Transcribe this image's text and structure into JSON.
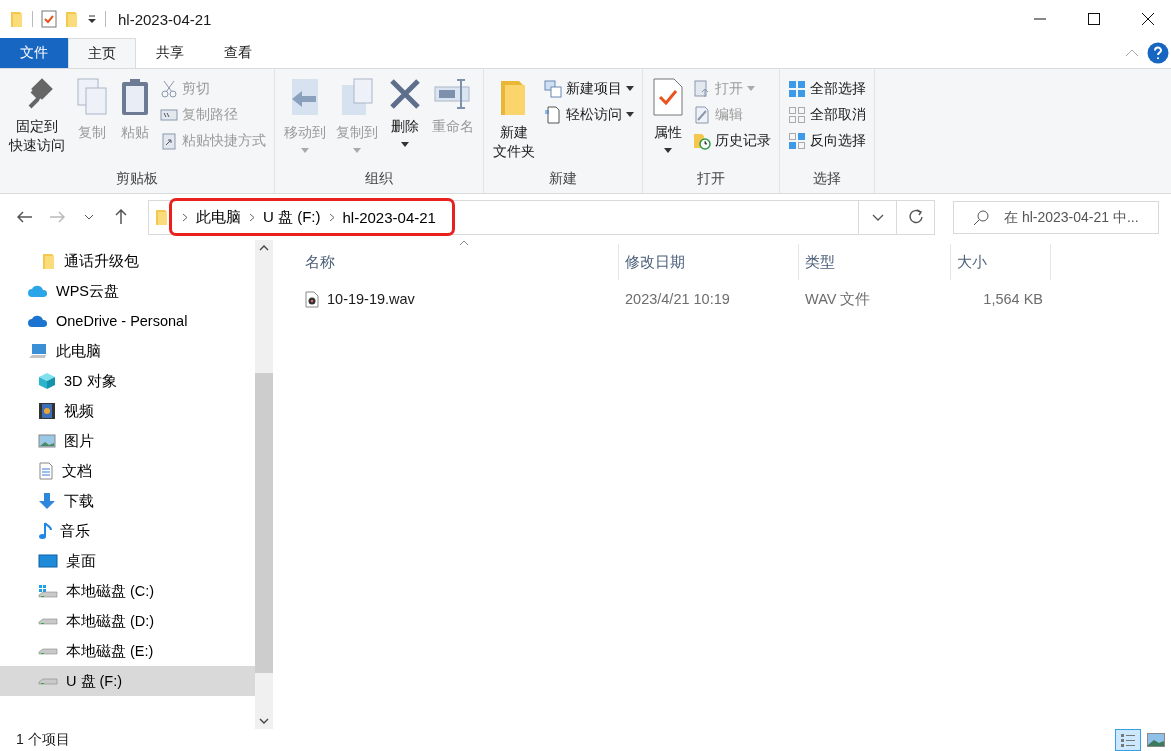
{
  "title_bar": {
    "title": "hl-2023-04-21"
  },
  "ribbon_tabs": [
    {
      "label": "文件",
      "kind": "file",
      "selected": false
    },
    {
      "label": "主页",
      "kind": "tab",
      "selected": true
    },
    {
      "label": "共享",
      "kind": "tab",
      "selected": false
    },
    {
      "label": "查看",
      "kind": "tab",
      "selected": false
    }
  ],
  "ribbon_groups": [
    {
      "label": "剪贴板",
      "columns": [
        {
          "kind": "large",
          "items": [
            {
              "label_lines": [
                "固定到",
                "快速访问"
              ],
              "disabled": false,
              "dropdown": false
            }
          ]
        },
        {
          "kind": "large",
          "items": [
            {
              "label": "复制",
              "disabled": true,
              "dropdown": false
            }
          ]
        },
        {
          "kind": "large",
          "items": [
            {
              "label": "粘贴",
              "disabled": true,
              "dropdown": false
            }
          ]
        },
        {
          "kind": "stack",
          "items": [
            {
              "label": "剪切",
              "disabled": true,
              "dropdown": false
            },
            {
              "label": "复制路径",
              "disabled": true,
              "dropdown": false
            },
            {
              "label": "粘贴快捷方式",
              "disabled": true,
              "dropdown": false
            }
          ]
        }
      ]
    },
    {
      "label": "组织",
      "columns": [
        {
          "kind": "large",
          "items": [
            {
              "label": "移动到",
              "disabled": true,
              "dropdown": true
            }
          ]
        },
        {
          "kind": "large",
          "items": [
            {
              "label": "复制到",
              "disabled": true,
              "dropdown": true
            }
          ]
        },
        {
          "kind": "large",
          "items": [
            {
              "label": "删除",
              "disabled": false,
              "dropdown": true
            }
          ]
        },
        {
          "kind": "large",
          "items": [
            {
              "label": "重命名",
              "disabled": true,
              "dropdown": false
            }
          ]
        }
      ]
    },
    {
      "label": "新建",
      "columns": [
        {
          "kind": "large",
          "items": [
            {
              "label_lines": [
                "新建",
                "文件夹"
              ],
              "disabled": false,
              "dropdown": false
            }
          ]
        },
        {
          "kind": "stack",
          "items": [
            {
              "label": "新建项目",
              "disabled": false,
              "dropdown": true
            },
            {
              "label": "轻松访问",
              "disabled": false,
              "dropdown": true
            }
          ]
        }
      ]
    },
    {
      "label": "打开",
      "columns": [
        {
          "kind": "large",
          "items": [
            {
              "label": "属性",
              "disabled": false,
              "dropdown": true
            }
          ]
        },
        {
          "kind": "stack",
          "items": [
            {
              "label": "打开",
              "disabled": true,
              "dropdown": true
            },
            {
              "label": "编辑",
              "disabled": true,
              "dropdown": false
            },
            {
              "label": "历史记录",
              "disabled": false,
              "dropdown": false
            }
          ]
        }
      ]
    },
    {
      "label": "选择",
      "columns": [
        {
          "kind": "stack",
          "items": [
            {
              "label": "全部选择",
              "disabled": false,
              "dropdown": false
            },
            {
              "label": "全部取消",
              "disabled": false,
              "dropdown": false
            },
            {
              "label": "反向选择",
              "disabled": false,
              "dropdown": false
            }
          ]
        }
      ]
    }
  ],
  "address_bar": {
    "highlighted": true,
    "breadcrumbs": [
      "此电脑",
      "U 盘 (F:)",
      "hl-2023-04-21"
    ]
  },
  "search": {
    "placeholder": "在 hl-2023-04-21 中..."
  },
  "sidebar": {
    "quick_access_children": [
      {
        "label": "通话升级包",
        "selected": false
      }
    ],
    "items": [
      {
        "label": "WPS云盘",
        "selected": false
      },
      {
        "label": "OneDrive - Personal",
        "selected": false
      },
      {
        "label": "此电脑",
        "selected": false,
        "children": [
          {
            "label": "3D 对象",
            "selected": false
          },
          {
            "label": "视频",
            "selected": false
          },
          {
            "label": "图片",
            "selected": false
          },
          {
            "label": "文档",
            "selected": false
          },
          {
            "label": "下载",
            "selected": false
          },
          {
            "label": "音乐",
            "selected": false
          },
          {
            "label": "桌面",
            "selected": false
          },
          {
            "label": "本地磁盘 (C:)",
            "selected": false
          },
          {
            "label": "本地磁盘 (D:)",
            "selected": false
          },
          {
            "label": "本地磁盘 (E:)",
            "selected": false
          },
          {
            "label": "U 盘 (F:)",
            "selected": true
          }
        ]
      }
    ]
  },
  "columns": [
    {
      "label": "名称",
      "sorted": true
    },
    {
      "label": "修改日期",
      "sorted": false
    },
    {
      "label": "类型",
      "sorted": false
    },
    {
      "label": "大小",
      "sorted": false
    }
  ],
  "rows": [
    {
      "name": "10-19-19.wav",
      "modified": "2023/4/21 10:19",
      "type": "WAV 文件",
      "size": "1,564 KB",
      "selected": false
    }
  ],
  "status_bar": {
    "text": "1 个项目",
    "views": [
      {
        "selected": true
      },
      {
        "selected": false
      }
    ]
  }
}
